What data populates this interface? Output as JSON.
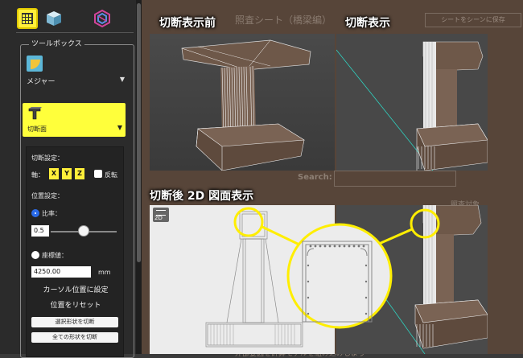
{
  "colors": {
    "accent_yellow": "#ffef3a",
    "panel_bg": "#2b2b2b",
    "bg_brown": "#574539",
    "viewport": "#3f3f3f",
    "highlight_ring": "#ffee00",
    "selection_blue": "#2a6be8"
  },
  "toolbar": {
    "icons": [
      "section-grid-icon",
      "cube-icon",
      "link-icon"
    ]
  },
  "toolbox": {
    "title": "ツールボックス",
    "measure": {
      "label": "メジャー",
      "icon": "ruler-triangle-icon"
    },
    "cut_panel": {
      "label": "切断面",
      "icon": "section-cut-icon"
    },
    "settings": {
      "cut_settings_label": "切断設定：",
      "axis_label": "軸：",
      "axes": [
        "X",
        "Y",
        "Z"
      ],
      "flip_label": "反転",
      "position_settings_label": "位置設定：",
      "ratio_label": "比率：",
      "ratio_value": "0.5",
      "ratio_level": 0.5,
      "coord_label": "座標値：",
      "coord_value": "4250.00",
      "coord_unit": "mm",
      "set_cursor_label": "カーソル位置に設定",
      "reset_label": "位置をリセット",
      "cut_selected_label": "選択形状を切断",
      "cut_all_label": "全ての形状を切断"
    }
  },
  "background": {
    "sheet_title": "照査シート（橋梁編）",
    "save_button": "シートをシーンに保存",
    "search_label": "Search:",
    "target_label": "照査対象",
    "bottom_text": "外部要因を計算モデルを組み込みしよう"
  },
  "captions": {
    "before": "切断表示前",
    "section_view": "切断表示",
    "after_2d": "切断後 2D 図面表示"
  },
  "badge_2d": "2D"
}
